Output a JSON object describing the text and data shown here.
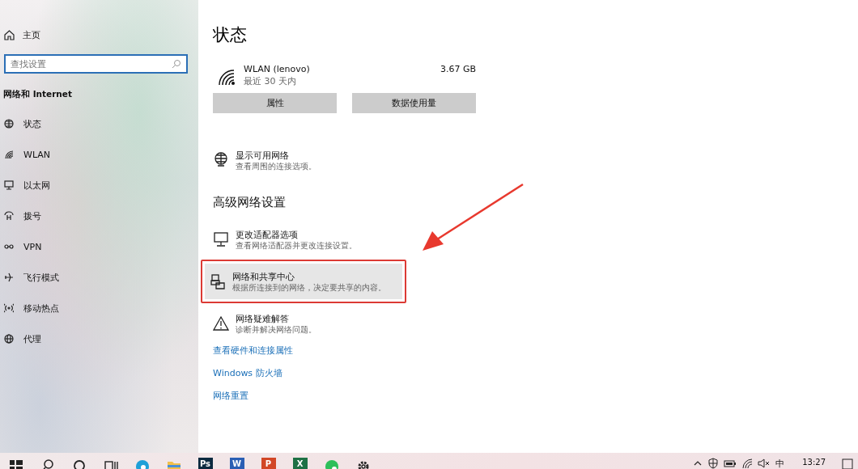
{
  "sidebar": {
    "home": "主页",
    "search": {
      "placeholder": "查找设置"
    },
    "section": "网络和 Internet",
    "items": [
      {
        "label": "状态",
        "selected": false
      },
      {
        "label": "WLAN",
        "selected": false
      },
      {
        "label": "以太网",
        "selected": false
      },
      {
        "label": "拨号",
        "selected": false
      },
      {
        "label": "VPN",
        "selected": false
      },
      {
        "label": "飞行模式",
        "selected": false
      },
      {
        "label": "移动热点",
        "selected": false
      },
      {
        "label": "代理",
        "selected": false
      }
    ]
  },
  "main": {
    "title": "状态",
    "connection": {
      "name": "WLAN (lenovo)",
      "period": "最近 30 天内",
      "usage": "3.67 GB"
    },
    "buttons": [
      "属性",
      "数据使用量"
    ],
    "show_networks": {
      "title": "显示可用网络",
      "description": "查看周围的连接选项。"
    },
    "advanced": {
      "heading": "高级网络设置",
      "items": [
        {
          "title": "更改适配器选项",
          "description": "查看网络适配器并更改连接设置。",
          "highlighted": false
        },
        {
          "title": "网络和共享中心",
          "description": "根据所连接到的网络，决定要共享的内容。",
          "highlighted": true
        },
        {
          "title": "网络疑难解答",
          "description": "诊断并解决网络问题。",
          "highlighted": false
        }
      ]
    },
    "links": [
      "查看硬件和连接属性",
      "Windows 防火墙",
      "网络重置"
    ]
  },
  "annotations": [
    {
      "kind": "arrow"
    }
  ],
  "taskbar": {
    "apps": [
      {
        "kind": "plain"
      },
      {
        "kind": "plain"
      },
      {
        "kind": "plain"
      },
      {
        "kind": "plain"
      },
      {
        "kind": "plain"
      },
      {
        "kind": "plain"
      },
      {
        "kind": "lettered",
        "label": "Ps",
        "color": "#0b2a3f"
      },
      {
        "kind": "lettered",
        "label": "W",
        "color": "#2b5fb4"
      },
      {
        "kind": "lettered",
        "label": "P",
        "color": "#d24726"
      },
      {
        "kind": "lettered",
        "label": "X",
        "color": "#1e7145"
      },
      {
        "kind": "plain"
      },
      {
        "kind": "plain"
      }
    ],
    "input_method": "中",
    "clock": "13:27"
  }
}
